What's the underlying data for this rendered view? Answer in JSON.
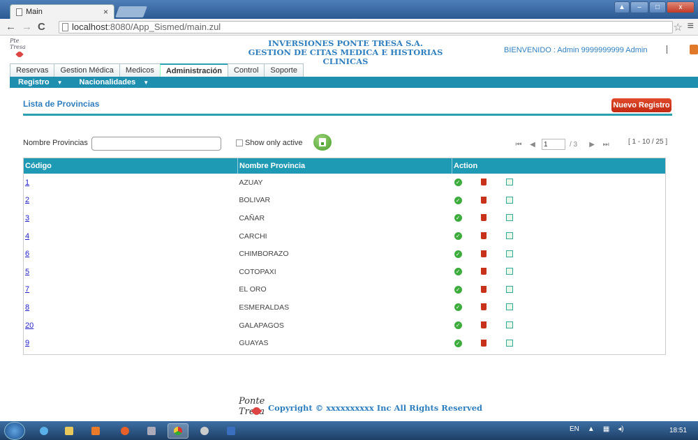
{
  "browser": {
    "tab_title": "Main",
    "tab_close": "×",
    "url_host": "localhost",
    "url_rest": ":8080/App_Sismed/main.zul"
  },
  "header": {
    "company_line1": "INVERSIONES PONTE TRESA S.A.",
    "company_line2": "GESTION DE CITAS MEDICA E HISTORIAS CLINICAS",
    "welcome": "BIENVENIDO : Admin 9999999999 Admin"
  },
  "tabs": [
    "Reservas",
    "Gestion Médica",
    "Medicos",
    "Administración",
    "Control",
    "Soporte"
  ],
  "active_tab": "Administración",
  "subnav": {
    "items": [
      "Registro",
      "Nacionalidades"
    ]
  },
  "section": {
    "title": "Lista de Provincias",
    "new_button": "Nuevo Registro"
  },
  "filter": {
    "label": "Nombre Provincias",
    "value": "",
    "show_active_label": "Show only active"
  },
  "pager": {
    "current_page": "1",
    "total_pages": "/ 3",
    "range": "[ 1 - 10 / 25 ]"
  },
  "table": {
    "headers": [
      "Código",
      "Nombre Provincia",
      "Action"
    ],
    "rows": [
      {
        "codigo": "1",
        "nombre": "AZUAY"
      },
      {
        "codigo": "2",
        "nombre": "BOLIVAR"
      },
      {
        "codigo": "3",
        "nombre": "CAÑAR"
      },
      {
        "codigo": "4",
        "nombre": "CARCHI"
      },
      {
        "codigo": "6",
        "nombre": "CHIMBORAZO"
      },
      {
        "codigo": "5",
        "nombre": "COTOPAXI"
      },
      {
        "codigo": "7",
        "nombre": "EL ORO"
      },
      {
        "codigo": "8",
        "nombre": "ESMERALDAS"
      },
      {
        "codigo": "20",
        "nombre": "GALAPAGOS"
      },
      {
        "codigo": "9",
        "nombre": "GUAYAS"
      }
    ]
  },
  "footer": {
    "logo_text": "Ponte Tresa",
    "copyright": "Copyright © xxxxxxxxxx Inc All Rights Reserved"
  },
  "taskbar": {
    "lang": "EN",
    "clock": "18:51"
  }
}
